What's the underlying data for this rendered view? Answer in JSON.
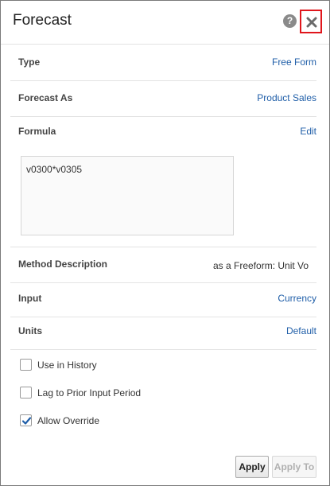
{
  "dialog": {
    "title": "Forecast",
    "help_icon": "question-circle-icon",
    "close_icon": "close-x-icon"
  },
  "fields": {
    "type": {
      "label": "Type",
      "value": "Free Form"
    },
    "forecast_as": {
      "label": "Forecast As",
      "value": "Product Sales"
    },
    "formula": {
      "label": "Formula",
      "edit_label": "Edit",
      "text": "v0300*v0305"
    },
    "method_description": {
      "label": "Method Description",
      "value": "as a Freeform:  Unit Vo"
    },
    "input": {
      "label": "Input",
      "value": "Currency"
    },
    "units": {
      "label": "Units",
      "value": "Default"
    }
  },
  "options": [
    {
      "label": "Use in History",
      "checked": false
    },
    {
      "label": "Lag to Prior Input Period",
      "checked": false
    },
    {
      "label": "Allow Override",
      "checked": true
    }
  ],
  "buttons": {
    "apply": "Apply",
    "apply_to": "Apply To"
  },
  "colors": {
    "link": "#1f5ea8",
    "close_highlight": "#e0161c",
    "checkmark": "#1f5ea8"
  }
}
